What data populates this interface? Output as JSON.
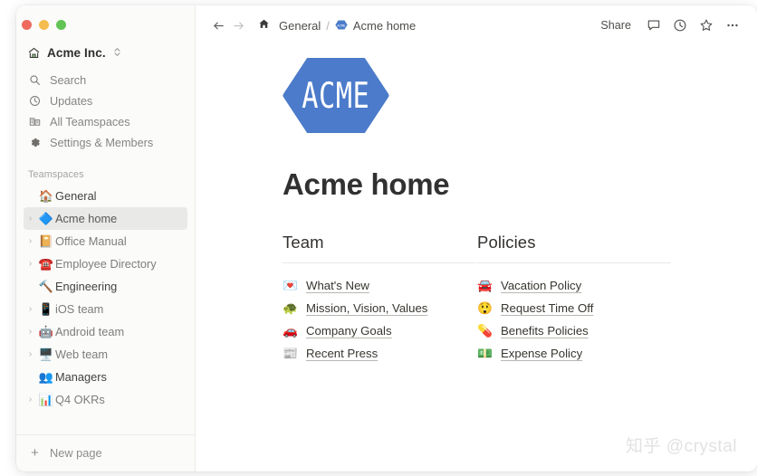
{
  "window": {
    "traffic_lights": [
      {
        "name": "close",
        "color": "#ee6a5f"
      },
      {
        "name": "minimize",
        "color": "#f5bd4f"
      },
      {
        "name": "zoom",
        "color": "#61c454"
      }
    ]
  },
  "sidebar": {
    "workspace": {
      "icon": "house-icon",
      "name": "Acme Inc.",
      "chevron": "⌃⌄"
    },
    "nav": [
      {
        "icon": "search-icon",
        "label": "Search"
      },
      {
        "icon": "clock-icon",
        "label": "Updates"
      },
      {
        "icon": "teamspaces-icon",
        "label": "All Teamspaces"
      },
      {
        "icon": "gear-icon",
        "label": "Settings & Members"
      }
    ],
    "section_title": "Teamspaces",
    "tree": [
      {
        "label": "General",
        "emoji": "🏠",
        "chevron": false,
        "top": true,
        "selected": false
      },
      {
        "label": "Acme home",
        "emoji": "🔷",
        "chevron": true,
        "top": false,
        "selected": true
      },
      {
        "label": "Office Manual",
        "emoji": "📔",
        "chevron": true,
        "top": false,
        "selected": false
      },
      {
        "label": "Employee Directory",
        "emoji": "☎️",
        "chevron": true,
        "top": false,
        "selected": false
      },
      {
        "label": "Engineering",
        "emoji": "🔨",
        "chevron": false,
        "top": true,
        "selected": false
      },
      {
        "label": "iOS team",
        "emoji": "📱",
        "chevron": true,
        "top": false,
        "selected": false
      },
      {
        "label": "Android team",
        "emoji": "🤖",
        "chevron": true,
        "top": false,
        "selected": false
      },
      {
        "label": "Web team",
        "emoji": "🖥️",
        "chevron": true,
        "top": false,
        "selected": false
      },
      {
        "label": "Managers",
        "emoji": "👥",
        "chevron": false,
        "top": true,
        "selected": false
      },
      {
        "label": "Q4 OKRs",
        "emoji": "📊",
        "chevron": true,
        "top": false,
        "selected": false
      }
    ],
    "new_page_label": "New page"
  },
  "topbar": {
    "back_icon": "arrow-left-icon",
    "forward_icon": "arrow-right-icon",
    "breadcrumb": {
      "home_icon": "home-icon",
      "parent": "General",
      "separator": "/",
      "current_emoji": "🔷",
      "current": "Acme home"
    },
    "share_label": "Share",
    "actions": [
      {
        "icon": "comment-icon"
      },
      {
        "icon": "clock-history-icon"
      },
      {
        "icon": "star-icon"
      },
      {
        "icon": "more-dots-icon"
      }
    ]
  },
  "page": {
    "logo": {
      "text": "ACME",
      "shape": "hexagon",
      "color": "#4b7bca"
    },
    "title": "Acme home",
    "columns": [
      {
        "heading": "Team",
        "links": [
          {
            "emoji": "💌",
            "label": "What's New"
          },
          {
            "emoji": "🐢",
            "label": "Mission, Vision, Values"
          },
          {
            "emoji": "🚗",
            "label": "Company Goals"
          },
          {
            "emoji": "📰",
            "label": "Recent Press"
          }
        ]
      },
      {
        "heading": "Policies",
        "links": [
          {
            "emoji": "🚘",
            "label": "Vacation Policy"
          },
          {
            "emoji": "😲",
            "label": "Request Time Off"
          },
          {
            "emoji": "💊",
            "label": "Benefits Policies"
          },
          {
            "emoji": "💵",
            "label": "Expense Policy"
          }
        ]
      }
    ]
  },
  "watermark": "知乎 @crystal"
}
